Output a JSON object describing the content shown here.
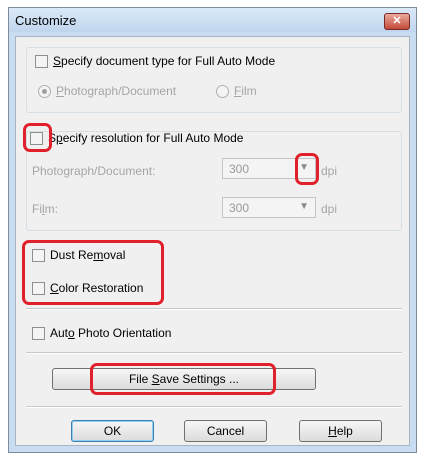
{
  "window": {
    "title": "Customize",
    "close_glyph": "✕"
  },
  "doc_type_group": {
    "checkbox_label_pre": "",
    "checkbox_label_u": "S",
    "checkbox_label_post": "pecify document type for Full Auto Mode",
    "option_photo_u": "P",
    "option_photo_rest": "hotograph/Document",
    "option_film_u": "F",
    "option_film_rest": "ilm",
    "selected": "Photograph/Document"
  },
  "resolution_group": {
    "checkbox_label_pre": "S",
    "checkbox_label_u": "p",
    "checkbox_label_post": "ecify resolution for Full Auto Mode",
    "photo_label": "Photograph/Document:",
    "photo_value": "300",
    "film_label_pre": "Fi",
    "film_label_u": "l",
    "film_label_post": "m:",
    "film_value": "300",
    "unit": "dpi",
    "arrow_glyph": "▼"
  },
  "options": {
    "dust_pre": "Dust Re",
    "dust_u": "m",
    "dust_post": "oval",
    "color_u": "C",
    "color_post": "olor Restoration",
    "orient_pre": "Aut",
    "orient_u": "o",
    "orient_post": " Photo Orientation"
  },
  "buttons": {
    "file_save_pre": "File ",
    "file_save_u": "S",
    "file_save_post": "ave Settings ...",
    "ok": "OK",
    "cancel": "Cancel",
    "help_u": "H",
    "help_post": "elp"
  },
  "colors": {
    "highlight": "#e0202a",
    "frame": "#c8ddf2",
    "dialog_bg": "#f0f0f0"
  }
}
